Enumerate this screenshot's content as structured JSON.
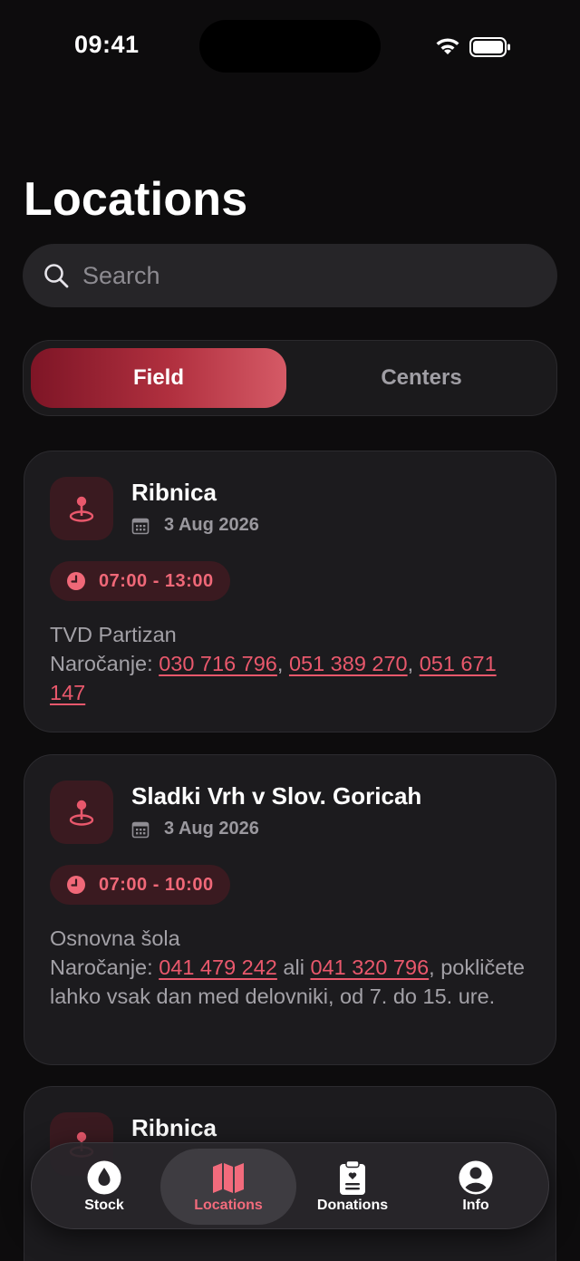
{
  "status_bar": {
    "time": "09:41"
  },
  "header": {
    "title": "Locations"
  },
  "search": {
    "placeholder": "Search",
    "icon": "magnifier-icon"
  },
  "segments": {
    "field_label": "Field",
    "centers_label": "Centers",
    "selected": "Field"
  },
  "cards": [
    {
      "name": "Ribnica",
      "date": "3 Aug 2026",
      "time": "07:00 - 13:00",
      "place": "TVD Partizan",
      "booking_prefix": "Naročanje: ",
      "phone1": "030 716 796",
      "sep1": ", ",
      "phone2": "051 389 270",
      "sep2": ", ",
      "phone3": "051 671 147"
    },
    {
      "name": "Sladki Vrh v Slov. Goricah",
      "date": "3 Aug 2026",
      "time": "07:00 - 10:00",
      "place": "Osnovna šola",
      "booking_prefix": "Naročanje: ",
      "phone1": "041 479 242",
      "sep1": " ali ",
      "phone2": "041 320 796",
      "tail": ", pokličete lahko vsak dan med delovniki, od 7. do 15. ure."
    },
    {
      "name": "Ribnica"
    }
  ],
  "tabbar": {
    "tabs": [
      {
        "label": "Stock",
        "icon": "blood-drop-icon"
      },
      {
        "label": "Locations",
        "icon": "map-icon",
        "active": true
      },
      {
        "label": "Donations",
        "icon": "clipboard-heart-icon"
      },
      {
        "label": "Info",
        "icon": "person-circle-icon"
      }
    ]
  },
  "colors": {
    "background": "#0d0c0d",
    "card": "#1c1b1e",
    "accent": "#e9586c",
    "accent_dark": "#7e1526"
  }
}
